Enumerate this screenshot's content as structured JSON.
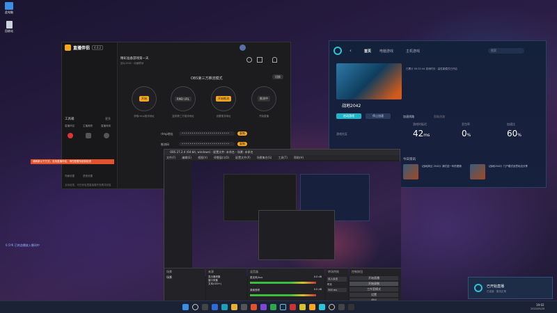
{
  "desktop": {
    "icons": [
      {
        "label": "此电脑"
      },
      {
        "label": "回收站"
      }
    ],
    "side_text": "0.5YK 已热血播放入播间中"
  },
  "live_app": {
    "brand": "直播伴侣",
    "version": "4.0.2",
    "room_title": "精彩准备游戏第一天",
    "room_sub": "战斗2042 · 动画联动",
    "mode_label": "OBS第三方推流模式",
    "mode_switch": "切换",
    "steps": [
      {
        "tag": "开始",
        "caption": "获取rtmp推流地址"
      },
      {
        "tag": "RMB URL",
        "caption": "复制第三方推流地址"
      },
      {
        "tag": "开始推流",
        "caption": "设置推流地址"
      },
      {
        "tag": "推流中",
        "caption": "开始直播"
      }
    ],
    "rtmp_label": "rtmp地址",
    "rtmp_value": "••••••••••••••••••••••••",
    "key_label": "推流码",
    "key_value": "••••••••••••••••••••••••",
    "copy_label": "复制",
    "tools_title": "工具箱",
    "tools": [
      "直播伴侣",
      "主播美颜",
      "直播商城"
    ],
    "tools_more": "更多",
    "bottom_tools": [
      "场景设置",
      "语音设置"
    ],
    "alert_text": "请刷新以下方式，支持直播伴侣，请在配置系统前检查",
    "footer_text": "互动信息，可在伴侣里直接展开查看并回复"
  },
  "game_app": {
    "tabs": [
      "首页",
      "电脑游戏",
      "主机游戏"
    ],
    "search_placeholder": "搜索",
    "game_title": "战地2042",
    "game_meta": "已累计 00:32:44 游戏时长 · 高性能模式已开启",
    "stats": [
      {
        "label": "游戏时延迟",
        "value": "42",
        "unit": "ms"
      },
      {
        "label": "丢包率",
        "value": "0",
        "unit": "%"
      },
      {
        "label": "加速比",
        "value": "60",
        "unit": "%"
      }
    ],
    "start_button": "启动游戏",
    "stop_button": "停止加速",
    "related": "游戏社区",
    "hint_title": "今日资讯",
    "news": [
      {
        "text": "《战地风云 2042》我们这一年的更新"
      },
      {
        "text": "《战地2042》门户模式创意玩法分享"
      }
    ],
    "route_label": "加速线路",
    "route_sub": "智能选路"
  },
  "obs": {
    "title": "OBS 27.2.4 (64-bit, windows) - 配置文件: 未命名 - 场景: 未命名",
    "menu": [
      "文件(F)",
      "编辑(E)",
      "视图(V)",
      "停靠窗口(D)",
      "配置文件(P)",
      "场景集合(S)",
      "工具(T)",
      "帮助(H)"
    ],
    "docks": {
      "scenes": "场景",
      "sources": "来源",
      "mixer": "混音器",
      "transitions": "转场特效",
      "controls": "控制按钮"
    },
    "scenes": [
      "场景"
    ],
    "sources": [
      "显示器采集",
      "窗口采集",
      "文本(GDI+)"
    ],
    "mixer": [
      {
        "name": "麦克风/Aux",
        "level": "0.0 dB"
      },
      {
        "name": "桌面音频",
        "level": "0.0 dB"
      }
    ],
    "transition": "淡入淡出",
    "duration_label": "时长",
    "duration": "300 ms",
    "controls": [
      "开始直播",
      "开始录制",
      "工作室模式",
      "设置",
      "退出"
    ],
    "selected_label": "未选择源"
  },
  "toast": {
    "title": "已开始直播",
    "body": "已连接 · 推流正常"
  },
  "taskbar": {
    "time": "19:02",
    "date": "2022/05/20"
  }
}
